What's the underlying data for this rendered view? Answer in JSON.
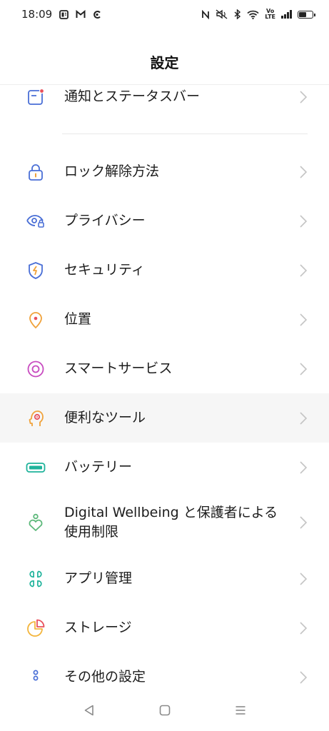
{
  "status": {
    "time": "18:09",
    "left_icons": [
      "news-icon",
      "gmail-icon",
      "c-app-icon"
    ],
    "right_icons": [
      "nfc-icon",
      "mute-icon",
      "bluetooth-icon",
      "wifi-icon",
      "volte-icon",
      "signal-icon",
      "battery-icon"
    ],
    "volte": "Vo\nLTE"
  },
  "header": {
    "title": "設定"
  },
  "items": [
    {
      "label": "通知とステータスバー",
      "icon": "notification-icon"
    },
    {
      "label": "ロック解除方法",
      "icon": "lock-icon"
    },
    {
      "label": "プライバシー",
      "icon": "privacy-eye-icon"
    },
    {
      "label": "セキュリティ",
      "icon": "shield-icon"
    },
    {
      "label": "位置",
      "icon": "location-pin-icon"
    },
    {
      "label": "スマートサービス",
      "icon": "smart-service-icon"
    },
    {
      "label": "便利なツール",
      "icon": "tools-head-icon"
    },
    {
      "label": "バッテリー",
      "icon": "battery-icon"
    },
    {
      "label": "Digital Wellbeing と保護者による使用制限",
      "label_line1": "Digital Wellbeing と保護者による",
      "label_line2": "使用制限",
      "icon": "wellbeing-heart-icon"
    },
    {
      "label": "アプリ管理",
      "icon": "app-management-icon"
    },
    {
      "label": "ストレージ",
      "icon": "storage-pie-icon"
    },
    {
      "label": "その他の設定",
      "icon": "more-settings-icon"
    }
  ],
  "colors": {
    "blue": "#4a6fd6",
    "orange": "#f0a23a",
    "magenta": "#c84cc0",
    "teal": "#1fb39b",
    "green": "#5cb87a",
    "yellow": "#f3b53c",
    "red": "#e8505b",
    "chevron": "#c4c4c4",
    "highlight": "#f6f6f6"
  },
  "navbar": {
    "icons": [
      "back-icon",
      "home-icon",
      "recents-icon"
    ]
  }
}
